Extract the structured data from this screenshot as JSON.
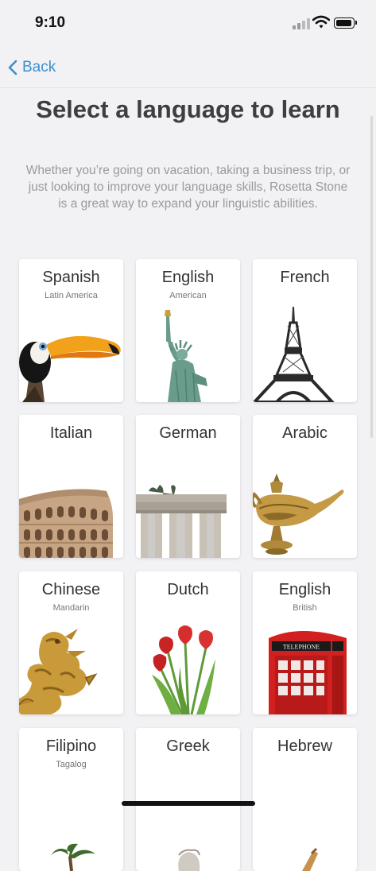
{
  "status": {
    "time": "9:10"
  },
  "nav": {
    "back_label": "Back"
  },
  "header": {
    "title": "Select a language to learn",
    "subtitle": "Whether you’re going on vacation, taking a business trip, or just looking to improve your language skills, Rosetta Stone is a great way to expand your linguistic abilities."
  },
  "languages": [
    {
      "name": "Spanish",
      "variant": "Latin America",
      "icon": "toucan-icon"
    },
    {
      "name": "English",
      "variant": "American",
      "icon": "statue-of-liberty-icon"
    },
    {
      "name": "French",
      "variant": "",
      "icon": "eiffel-tower-icon"
    },
    {
      "name": "Italian",
      "variant": "",
      "icon": "colosseum-icon"
    },
    {
      "name": "German",
      "variant": "",
      "icon": "brandenburg-gate-icon"
    },
    {
      "name": "Arabic",
      "variant": "",
      "icon": "oil-lamp-icon"
    },
    {
      "name": "Chinese",
      "variant": "Mandarin",
      "icon": "dragon-icon"
    },
    {
      "name": "Dutch",
      "variant": "",
      "icon": "tulips-icon"
    },
    {
      "name": "English",
      "variant": "British",
      "icon": "phone-box-icon"
    },
    {
      "name": "Filipino",
      "variant": "Tagalog",
      "icon": "palm-tree-icon"
    },
    {
      "name": "Greek",
      "variant": "",
      "icon": "greek-bust-icon"
    },
    {
      "name": "Hebrew",
      "variant": "",
      "icon": "scroll-icon"
    }
  ],
  "phone_box_sign": "TELEPHONE"
}
